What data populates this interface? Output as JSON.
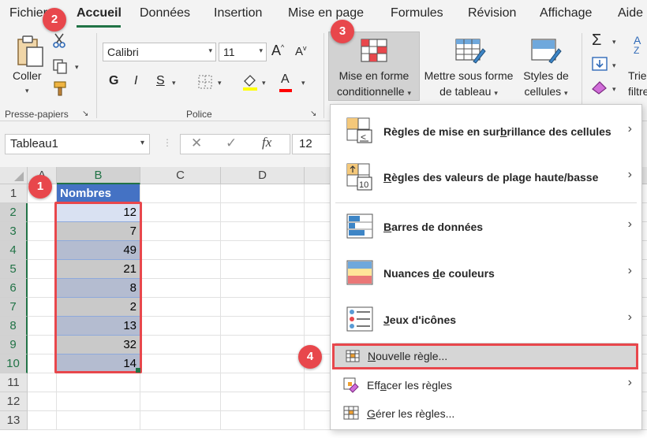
{
  "tabs": [
    "Fichier",
    "Accueil",
    "Données",
    "Insertion",
    "Mise en page",
    "Formules",
    "Révision",
    "Affichage",
    "Aide"
  ],
  "ribbon": {
    "clipboard": {
      "paste_label": "Coller",
      "group_label": "Presse-papiers"
    },
    "font": {
      "name": "Calibri",
      "size": "11",
      "bold": "G",
      "italic": "I",
      "underline": "S",
      "color_letter": "A",
      "grow": "A",
      "shrink": "A",
      "group_label": "Police"
    },
    "conditional_formatting": {
      "line1": "Mise en forme",
      "line2": "conditionnelle"
    },
    "format_table": {
      "line1": "Mettre sous forme",
      "line2": "de tableau"
    },
    "cell_styles": {
      "line1": "Styles de",
      "line2": "cellules"
    },
    "sort": {
      "line1": "Trier",
      "line2": "filtrer"
    }
  },
  "formula_bar": {
    "name_box": "Tableau1",
    "fx": "fx",
    "value": "12"
  },
  "grid": {
    "columns": [
      "A",
      "B",
      "C",
      "D"
    ],
    "rows": [
      "1",
      "2",
      "3",
      "4",
      "5",
      "6",
      "7",
      "8",
      "9",
      "10",
      "11",
      "12",
      "13"
    ],
    "header": "Nombres",
    "values": [
      "12",
      "7",
      "49",
      "21",
      "8",
      "2",
      "13",
      "32",
      "14"
    ]
  },
  "menu": {
    "items": [
      {
        "pre": "Règles de mise en sur",
        "u": "b",
        "post": "rillance des cellules"
      },
      {
        "pre": "",
        "u": "R",
        "post": "ègles des valeurs de plage haute/basse"
      },
      {
        "pre": "",
        "u": "B",
        "post": "arres de données"
      },
      {
        "pre": "Nuances ",
        "u": "d",
        "post": "e couleurs"
      },
      {
        "pre": "",
        "u": "J",
        "post": "eux d'icônes"
      }
    ],
    "new_rule": {
      "pre": "",
      "u": "N",
      "post": "ouvelle règle..."
    },
    "clear_rules": {
      "pre": "Eff",
      "u": "a",
      "post": "cer les règles"
    },
    "manage_rules": {
      "pre": "",
      "u": "G",
      "post": "érer les règles..."
    }
  },
  "badges": [
    "1",
    "2",
    "3",
    "4"
  ],
  "colors": {
    "accent_red": "#e8474c",
    "table_header": "#4472c4",
    "excel_green": "#217346"
  }
}
